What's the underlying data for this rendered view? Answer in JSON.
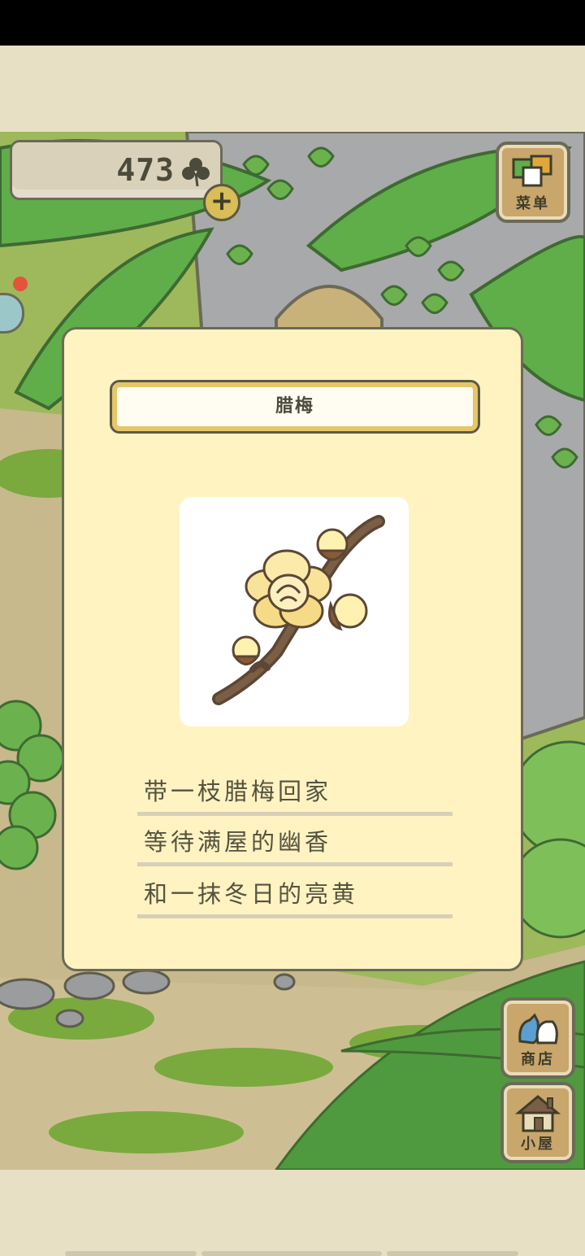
{
  "clover": {
    "count": "473",
    "icon": "clover-icon"
  },
  "buttons": {
    "add_clover": "+",
    "menu_label": "菜单",
    "shop_label": "商店",
    "house_label": "小屋"
  },
  "card": {
    "title": "腊梅",
    "item_image": "wintersweet-branch",
    "lines": [
      "带一枝腊梅回家",
      "等待满屋的幽香",
      "和一抹冬日的亮黄"
    ]
  },
  "colors": {
    "card_bg": "#fff3c2",
    "frame_border": "#6b6a57",
    "title_accent": "#e5c76a",
    "leaf_green": "#5fae4a",
    "ground": "#c7b98c"
  }
}
